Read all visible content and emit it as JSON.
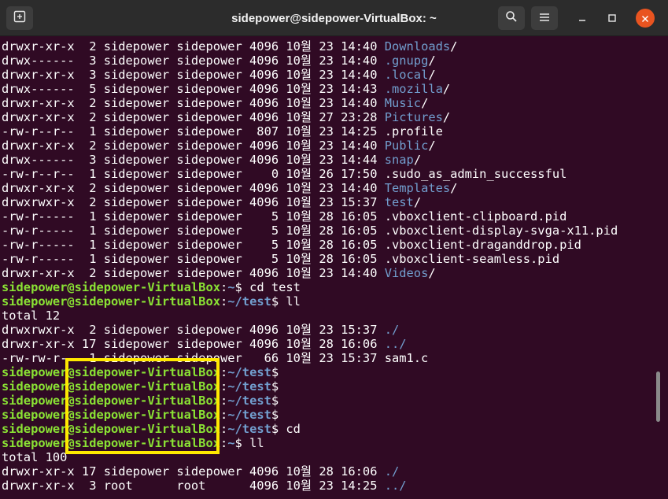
{
  "window": {
    "title": "sidepower@sidepower-VirtualBox: ~",
    "icons": {
      "new_tab": "new-tab-icon",
      "search": "search-icon",
      "menu": "hamburger-menu-icon",
      "minimize": "minimize-icon",
      "maximize": "maximize-icon",
      "close": "close-icon"
    },
    "colors": {
      "background": "#300a24",
      "titlebar": "#2c2c2c",
      "close_button": "#e95420",
      "prompt_user": "#8ae234",
      "directory": "#729fcf",
      "highlight_box": "#ffe800"
    }
  },
  "terminal": {
    "lines": [
      [
        {
          "t": "drwxr-xr-x  2 sidepower sidepower 4096 10월 23 14:40 "
        },
        {
          "t": "Downloads",
          "c": "dir"
        },
        {
          "t": "/"
        }
      ],
      [
        {
          "t": "drwx------  3 sidepower sidepower 4096 10월 23 14:40 "
        },
        {
          "t": ".gnupg",
          "c": "dir"
        },
        {
          "t": "/"
        }
      ],
      [
        {
          "t": "drwxr-xr-x  3 sidepower sidepower 4096 10월 23 14:40 "
        },
        {
          "t": ".local",
          "c": "dir"
        },
        {
          "t": "/"
        }
      ],
      [
        {
          "t": "drwx------  5 sidepower sidepower 4096 10월 23 14:43 "
        },
        {
          "t": ".mozilla",
          "c": "dir"
        },
        {
          "t": "/"
        }
      ],
      [
        {
          "t": "drwxr-xr-x  2 sidepower sidepower 4096 10월 23 14:40 "
        },
        {
          "t": "Music",
          "c": "dir"
        },
        {
          "t": "/"
        }
      ],
      [
        {
          "t": "drwxr-xr-x  2 sidepower sidepower 4096 10월 27 23:28 "
        },
        {
          "t": "Pictures",
          "c": "dir"
        },
        {
          "t": "/"
        }
      ],
      [
        {
          "t": "-rw-r--r--  1 sidepower sidepower  807 10월 23 14:25 .profile"
        }
      ],
      [
        {
          "t": "drwxr-xr-x  2 sidepower sidepower 4096 10월 23 14:40 "
        },
        {
          "t": "Public",
          "c": "dir"
        },
        {
          "t": "/"
        }
      ],
      [
        {
          "t": "drwx------  3 sidepower sidepower 4096 10월 23 14:44 "
        },
        {
          "t": "snap",
          "c": "dir"
        },
        {
          "t": "/"
        }
      ],
      [
        {
          "t": "-rw-r--r--  1 sidepower sidepower    0 10월 26 17:50 .sudo_as_admin_successful"
        }
      ],
      [
        {
          "t": "drwxr-xr-x  2 sidepower sidepower 4096 10월 23 14:40 "
        },
        {
          "t": "Templates",
          "c": "dir"
        },
        {
          "t": "/"
        }
      ],
      [
        {
          "t": "drwxrwxr-x  2 sidepower sidepower 4096 10월 23 15:37 "
        },
        {
          "t": "test",
          "c": "dir"
        },
        {
          "t": "/"
        }
      ],
      [
        {
          "t": "-rw-r-----  1 sidepower sidepower    5 10월 28 16:05 .vboxclient-clipboard.pid"
        }
      ],
      [
        {
          "t": "-rw-r-----  1 sidepower sidepower    5 10월 28 16:05 .vboxclient-display-svga-x11.pid"
        }
      ],
      [
        {
          "t": "-rw-r-----  1 sidepower sidepower    5 10월 28 16:05 .vboxclient-draganddrop.pid"
        }
      ],
      [
        {
          "t": "-rw-r-----  1 sidepower sidepower    5 10월 28 16:05 .vboxclient-seamless.pid"
        }
      ],
      [
        {
          "t": "drwxr-xr-x  2 sidepower sidepower 4096 10월 23 14:40 "
        },
        {
          "t": "Videos",
          "c": "dir"
        },
        {
          "t": "/"
        }
      ],
      [
        {
          "t": "sidepower@sidepower-VirtualBox",
          "c": "user"
        },
        {
          "t": ":"
        },
        {
          "t": "~",
          "c": "path"
        },
        {
          "t": "$ cd test"
        }
      ],
      [
        {
          "t": "sidepower@sidepower-VirtualBox",
          "c": "user"
        },
        {
          "t": ":"
        },
        {
          "t": "~/test",
          "c": "path"
        },
        {
          "t": "$ ll"
        }
      ],
      [
        {
          "t": "total 12"
        }
      ],
      [
        {
          "t": "drwxrwxr-x  2 sidepower sidepower 4096 10월 23 15:37 "
        },
        {
          "t": "./",
          "c": "dir"
        }
      ],
      [
        {
          "t": "drwxr-xr-x 17 sidepower sidepower 4096 10월 28 16:06 "
        },
        {
          "t": "../",
          "c": "dir"
        }
      ],
      [
        {
          "t": "-rw-rw-r--  1 sidepower sidepower   66 10월 23 15:37 sam1.c"
        }
      ],
      [
        {
          "t": "sidepower@sidepower-VirtualBox",
          "c": "user"
        },
        {
          "t": ":"
        },
        {
          "t": "~/test",
          "c": "path"
        },
        {
          "t": "$"
        }
      ],
      [
        {
          "t": "sidepower@sidepower-VirtualBox",
          "c": "user"
        },
        {
          "t": ":"
        },
        {
          "t": "~/test",
          "c": "path"
        },
        {
          "t": "$"
        }
      ],
      [
        {
          "t": "sidepower@sidepower-VirtualBox",
          "c": "user"
        },
        {
          "t": ":"
        },
        {
          "t": "~/test",
          "c": "path"
        },
        {
          "t": "$"
        }
      ],
      [
        {
          "t": "sidepower@sidepower-VirtualBox",
          "c": "user"
        },
        {
          "t": ":"
        },
        {
          "t": "~/test",
          "c": "path"
        },
        {
          "t": "$"
        }
      ],
      [
        {
          "t": "sidepower@sidepower-VirtualBox",
          "c": "user"
        },
        {
          "t": ":"
        },
        {
          "t": "~/test",
          "c": "path"
        },
        {
          "t": "$ cd"
        }
      ],
      [
        {
          "t": "sidepower@sidepower-VirtualBox",
          "c": "user"
        },
        {
          "t": ":"
        },
        {
          "t": "~",
          "c": "path"
        },
        {
          "t": "$ ll"
        }
      ],
      [
        {
          "t": "total 100"
        }
      ],
      [
        {
          "t": "drwxr-xr-x 17 sidepower sidepower 4096 10월 28 16:06 "
        },
        {
          "t": "./",
          "c": "dir"
        }
      ],
      [
        {
          "t": "drwxr-xr-x  3 root      root      4096 10월 23 14:25 "
        },
        {
          "t": "../",
          "c": "dir"
        }
      ]
    ]
  }
}
